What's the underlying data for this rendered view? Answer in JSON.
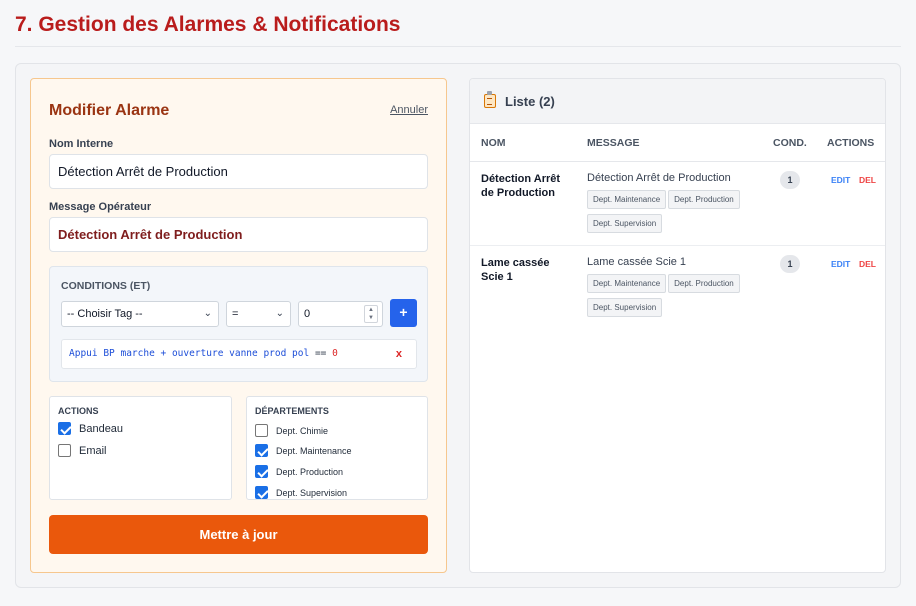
{
  "page": {
    "title": "7. Gestion des Alarmes & Notifications"
  },
  "form": {
    "title": "Modifier Alarme",
    "cancel_label": "Annuler",
    "name_label": "Nom Interne",
    "name_value": "Détection Arrêt de Production",
    "message_label": "Message Opérateur",
    "message_value": "Détection Arrêt de Production",
    "conditions": {
      "title": "CONDITIONS (ET)",
      "tag_select": "-- Choisir Tag --",
      "operator_select": "=",
      "value": "0",
      "add_label": "+",
      "items": [
        {
          "tag": "Appui BP marche + ouverture vanne prod pol",
          "op": "==",
          "value": "0",
          "remove": "x"
        }
      ]
    },
    "actions": {
      "title": "ACTIONS",
      "items": [
        {
          "label": "Bandeau",
          "checked": true
        },
        {
          "label": "Email",
          "checked": false
        }
      ]
    },
    "departments": {
      "title": "DÉPARTEMENTS",
      "items": [
        {
          "label": "Dept. Chimie",
          "checked": false
        },
        {
          "label": "Dept. Maintenance",
          "checked": true
        },
        {
          "label": "Dept. Production",
          "checked": true
        },
        {
          "label": "Dept. Supervision",
          "checked": true
        }
      ]
    },
    "submit_label": "Mettre à jour"
  },
  "list": {
    "title": "Liste (2)",
    "icon": "clipboard-icon",
    "columns": {
      "name": "NOM",
      "message": "MESSAGE",
      "cond": "COND.",
      "actions": "ACTIONS"
    },
    "edit_label": "EDIT",
    "del_label": "DEL",
    "rows": [
      {
        "name": "Détection Arrêt de Production",
        "message": "Détection Arrêt de Production",
        "departments": [
          "Dept. Maintenance",
          "Dept. Production",
          "Dept. Supervision"
        ],
        "cond": "1"
      },
      {
        "name": "Lame cassée Scie 1",
        "message": "Lame cassée Scie 1",
        "departments": [
          "Dept. Maintenance",
          "Dept. Production",
          "Dept. Supervision"
        ],
        "cond": "1"
      }
    ]
  },
  "colors": {
    "title": "#b91c1c",
    "accent": "#ea580c",
    "primary": "#2563eb",
    "danger": "#ef4444"
  }
}
